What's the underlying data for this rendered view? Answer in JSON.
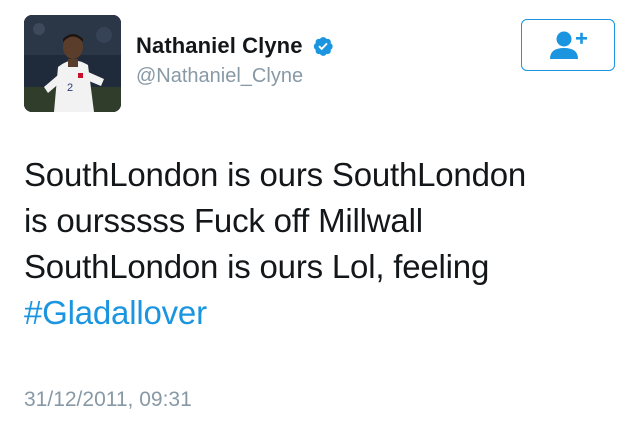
{
  "tweet": {
    "author": {
      "display_name": "Nathaniel Clyne",
      "handle": "@Nathaniel_Clyne",
      "verified": true,
      "avatar_icon": "player-photo-avatar"
    },
    "follow_button": {
      "icon": "add-user-icon"
    },
    "text_lines": [
      "SouthLondon is ours SouthLondon",
      "is oursssss Fuck off Millwall",
      "SouthLondon is ours Lol, feeling"
    ],
    "hashtag": "#Gladallover",
    "timestamp": "31/12/2011, 09:31"
  },
  "colors": {
    "accent": "#1b95e0",
    "text_primary": "#14171a",
    "text_secondary": "#8899a6"
  }
}
